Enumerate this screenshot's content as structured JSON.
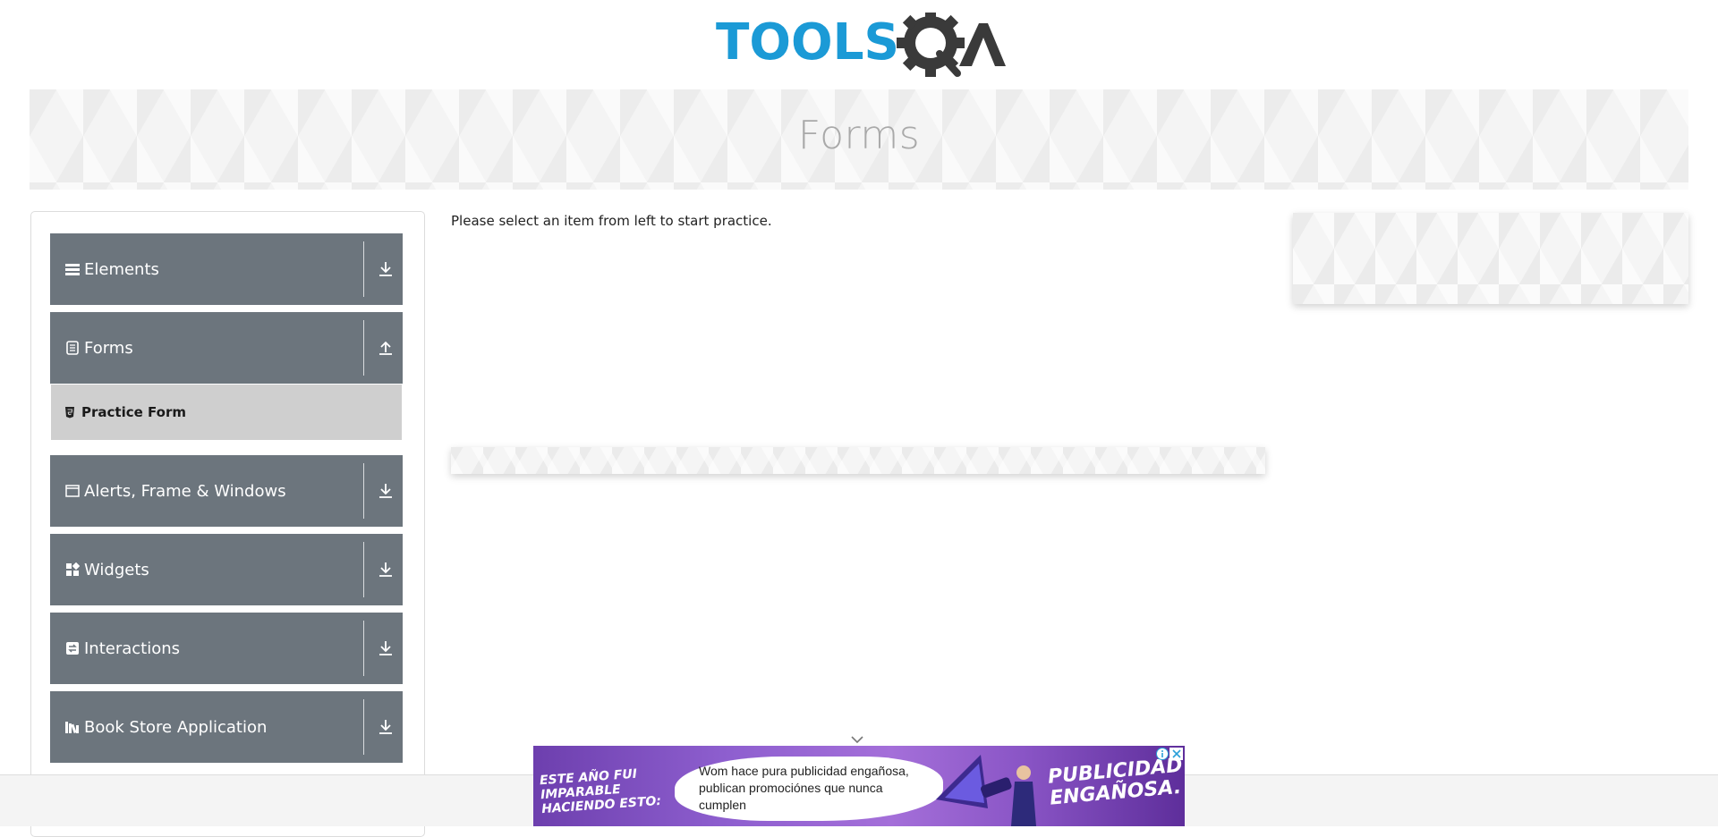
{
  "header": {
    "logo_text_primary": "TOOLS",
    "logo_text_secondary": "QA"
  },
  "banner": {
    "title": "Forms"
  },
  "sidebar": {
    "groups": [
      {
        "label": "Elements",
        "icon": "list-icon",
        "toggle": "download-icon",
        "expanded": false
      },
      {
        "label": "Forms",
        "icon": "form-icon",
        "toggle": "upload-icon",
        "expanded": true,
        "items": [
          {
            "label": "Practice Form",
            "icon": "html5-icon"
          }
        ]
      },
      {
        "label": "Alerts, Frame & Windows",
        "icon": "window-icon",
        "toggle": "download-icon",
        "expanded": false
      },
      {
        "label": "Widgets",
        "icon": "widgets-icon",
        "toggle": "download-icon",
        "expanded": false
      },
      {
        "label": "Interactions",
        "icon": "interactions-icon",
        "toggle": "download-icon",
        "expanded": false
      },
      {
        "label": "Book Store Application",
        "icon": "books-icon",
        "toggle": "download-icon",
        "expanded": false
      }
    ]
  },
  "main": {
    "instruction": "Please select an item from left to start practice."
  },
  "ad": {
    "left_text": "ESTE AÑO FUI IMPARABLE HACIENDO ESTO:",
    "center_text": "Wom hace pura publicidad engañosa, publican promociónes que nunca cumplen",
    "right_text": "PUBLICIDAD ENGAÑOSA.",
    "info_icon": "info-icon",
    "close_icon": "close-icon"
  },
  "colors": {
    "logo_blue": "#1b9ad6",
    "logo_dark": "#3a3a3a",
    "group_bg": "#6c757d",
    "selected_item_bg": "#cfcfcf",
    "banner_title": "#a9a9a9",
    "ad_purple": "#8e5fcf"
  }
}
